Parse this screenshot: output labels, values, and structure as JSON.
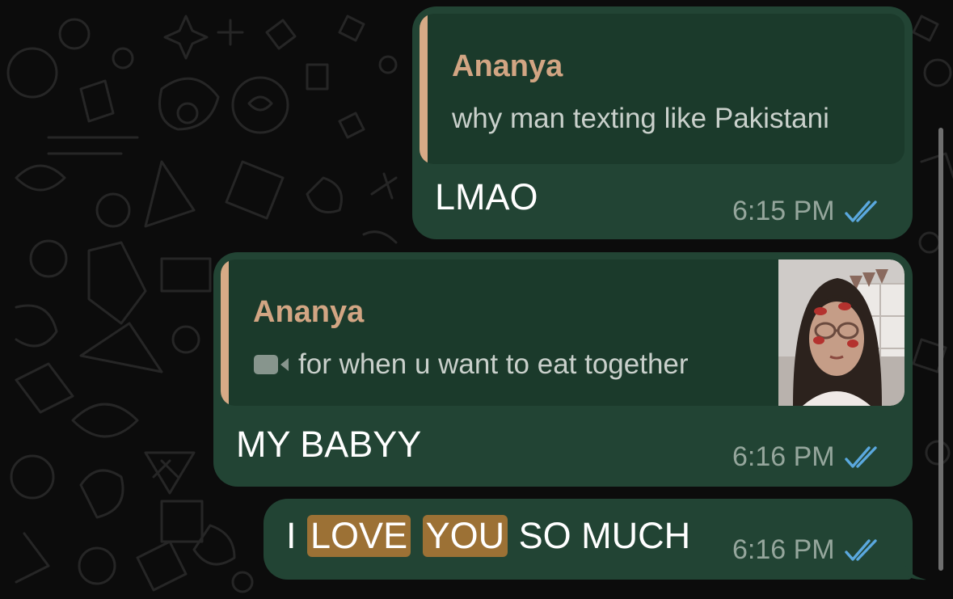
{
  "messages": [
    {
      "quote": {
        "author": "Ananya",
        "text": "why man texting like Pakistani"
      },
      "text": "LMAO",
      "time": "6:15 PM",
      "status": "read-double-check-icon"
    },
    {
      "quote": {
        "author": "Ananya",
        "media_icon": "video-camera-icon",
        "text": "for when u want to eat together",
        "has_thumbnail": true
      },
      "text": "MY BABYY",
      "time": "6:16 PM",
      "status": "read-double-check-icon"
    },
    {
      "text_parts": [
        "I",
        "LOVE",
        "YOU",
        "SO MUCH"
      ],
      "highlighted": [
        "LOVE",
        "YOU"
      ],
      "time": "6:16 PM",
      "status": "read-double-check-icon"
    }
  ],
  "colors": {
    "background": "#0c0c0c",
    "bubble_outgoing": "#224434",
    "quote_background": "#1b3a2b",
    "quote_bar": "#d7aa86",
    "quote_author": "#d2a583",
    "read_ticks": "#5aa8de",
    "search_highlight": "#9c7135"
  }
}
